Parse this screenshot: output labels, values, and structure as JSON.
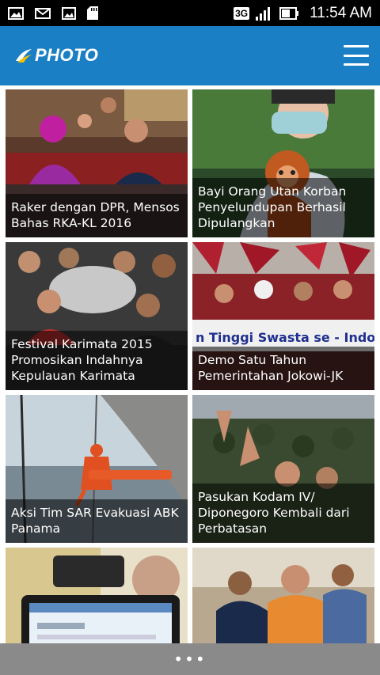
{
  "status_bar": {
    "time": "11:54 AM",
    "network": "3G",
    "icons": [
      "image-icon",
      "mail-icon",
      "picture-icon",
      "sdcard-icon",
      "signal-icon",
      "battery-icon"
    ]
  },
  "app_bar": {
    "title": "PHOTO",
    "menu_icon": "hamburger-menu-icon",
    "color": "#1a7fc4"
  },
  "cards": [
    {
      "caption": "Raker dengan DPR, Mensos Bahas RKA-KL 2016"
    },
    {
      "caption": "Bayi Orang Utan Korban Penyelundupan Berhasil Dipulangkan"
    },
    {
      "caption": "Festival Karimata 2015 Promosikan Indahnya Kepulauan Karimata"
    },
    {
      "caption": "Demo Satu Tahun Pemerintahan Jokowi-JK"
    },
    {
      "caption": "Aksi Tim SAR Evakuasi ABK Panama"
    },
    {
      "caption": "Pasukan Kodam IV/ Diponegoro Kembali dari Perbatasan"
    },
    {
      "caption": ""
    },
    {
      "caption": ""
    }
  ],
  "bottom_bar": {
    "label": "•••"
  },
  "banner_text": "n Tinggi Swasta se - Indo"
}
